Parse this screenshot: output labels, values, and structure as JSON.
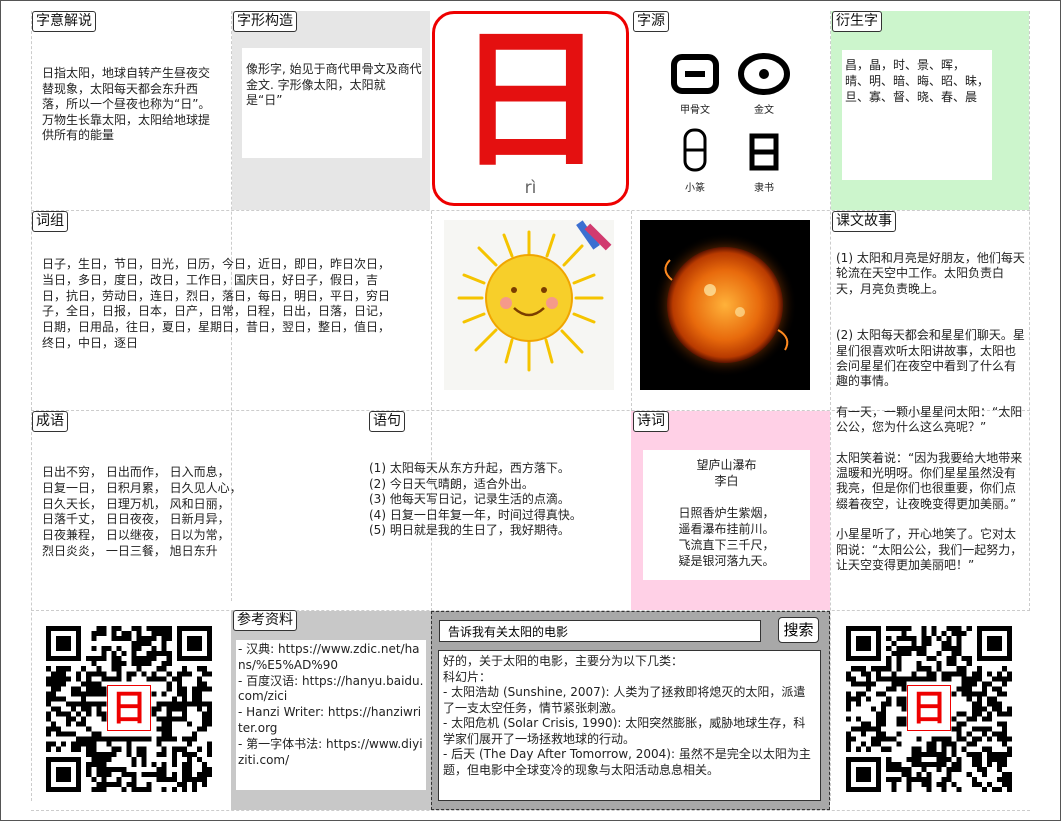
{
  "sections": {
    "meaning": {
      "title": "字意解说",
      "text": "日指太阳，地球自转产生昼夜交替现象，太阳每天都会东升西落，所以一个昼夜也称为“日”。万物生长靠太阳，太阳给地球提供所有的能量"
    },
    "structure": {
      "title": "字形构造",
      "text": "像形字, 始见于商代甲骨文及商代金文. 字形像太阳，太阳就是“日”"
    },
    "character": {
      "glyph": "日",
      "pinyin": "rì"
    },
    "origin": {
      "title": "字源",
      "glyphs": [
        {
          "label": "甲骨文",
          "icon": "oracle-bone-ri-icon"
        },
        {
          "label": "金文",
          "icon": "bronze-ri-icon"
        },
        {
          "label": "小篆",
          "icon": "small-seal-ri-icon"
        },
        {
          "label": "隶书",
          "icon": "clerical-ri-icon"
        }
      ]
    },
    "derived": {
      "title": "衍生字",
      "text": "昌，晶，时、景、晖， 晴、明、暗、晦、昭、昧，旦、寡、督、晓、春、晨"
    },
    "phrases": {
      "title": "词组",
      "text": "日子，生日，节日，日光，日历，今日，近日，即日，昨日次日，当日，多日，度日，改日，工作日，国庆日，好日子，假日，吉日，抗日，劳动日，连日，烈日，落日，每日，明日，平日，穷日子，全日，日报，日本，日产，日常，日程，日出，日落，日记，日期，日用品，往日，夏日，星期日，昔日，翌日，整日，值日，终日，中日，逐日"
    },
    "story": {
      "title": "课文故事",
      "paragraphs": [
        "(1) 太阳和月亮是好朋友，他们每天轮流在天空中工作。太阳负责白天，月亮负责晚上。",
        "(2) 太阳每天都会和星星们聊天。星星们很喜欢听太阳讲故事，太阳也会问星星们在夜空中看到了什么有趣的事情。",
        "有一天，一颗小星星问太阳：“太阳公公，您为什么这么亮呢？”",
        "太阳笑着说：“因为我要给大地带来温暖和光明呀。你们星星虽然没有我亮，但是你们也很重要，你们点缀着夜空，让夜晚变得更加美丽。”",
        "小星星听了，开心地笑了。它对太阳说：“太阳公公，我们一起努力，让天空变得更加美丽吧！”"
      ]
    },
    "idioms": {
      "title": "成语",
      "lines": [
        "日出不穷， 日出而作， 日入而息，",
        "日复一日， 日积月累， 日久见人心，",
        "日久天长， 日理万机， 风和日丽，",
        "日落千丈， 日日夜夜， 日新月异，",
        "日夜兼程， 日以继夜， 日以为常，",
        "烈日炎炎， 一日三餐， 旭日东升"
      ]
    },
    "sentences": {
      "title": "语句",
      "lines": [
        "(1)  太阳每天从东方升起，西方落下。",
        "(2)  今日天气晴朗，适合外出。",
        "(3)  他每天写日记，记录生活的点滴。",
        "(4)  日复一日年复一年，时间过得真快。",
        "(5)  明日就是我的生日了，我好期待。"
      ]
    },
    "poem": {
      "title": "诗词",
      "name": "望庐山瀑布",
      "author": "李白",
      "lines": [
        "日照香炉生紫烟，",
        "遥看瀑布挂前川。",
        "飞流直下三千尺，",
        "疑是银河落九天。"
      ]
    },
    "references": {
      "title": "参考资料",
      "lines": [
        "- 汉典: https://www.zdic.net/hans/%E5%AD%90",
        "- 百度汉语: https://hanyu.baidu.com/zici",
        "- Hanzi Writer: https://hanziwriter.org",
        "- 第一字体书法: https://www.diyiziti.com/"
      ]
    },
    "search": {
      "query": "告诉我有关太阳的电影",
      "button": "搜索",
      "answer_lines": [
        "好的，关于太阳的电影，主要分为以下几类：",
        "科幻片：",
        "- 太阳浩劫 (Sunshine, 2007): 人类为了拯救即将熄灭的太阳，派遣了一支太空任务，情节紧张刺激。",
        "- 太阳危机 (Solar Crisis, 1990): 太阳突然膨胀，威胁地球生存，科学家们展开了一场拯救地球的行动。",
        "- 后天 (The Day After Tomorrow, 2004): 虽然不是完全以太阳为主题，但电影中全球变冷的现象与太阳活动息息相关。"
      ]
    },
    "qr": {
      "center_char": "日"
    }
  },
  "colors": {
    "accent": "#e41010",
    "structure_bg": "#e6e6e6",
    "derived_bg": "#ccf5cc",
    "poem_bg": "#ffd0e6",
    "reference_bg": "#c8c8c8",
    "search_bg": "#a8a8a8"
  }
}
